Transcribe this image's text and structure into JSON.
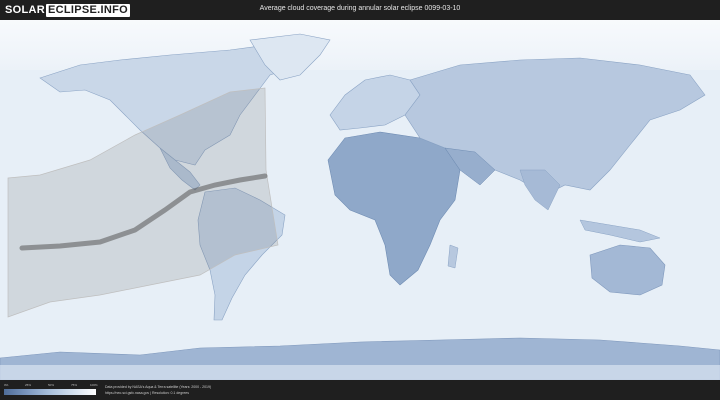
{
  "logo": {
    "part1": "SOLAR",
    "part2": "ECLIPSE.INFO"
  },
  "title": "Average cloud coverage during annular solar eclipse 0099-03-10",
  "legend": {
    "colors": [
      "#4f6d99",
      "#7b97bf",
      "#a9c0dc",
      "#d4e1ef",
      "#ffffff"
    ],
    "ticks": [
      "0%",
      "25%",
      "50%",
      "75%",
      "100%"
    ]
  },
  "credit": {
    "line1": "Data provided by NASA's Aqua & Terra satellite (Years: 2000 - 2019)",
    "line2": "https://neo.sci.gsfc.nasa.gov | Resolution: 0.1 degrees"
  }
}
